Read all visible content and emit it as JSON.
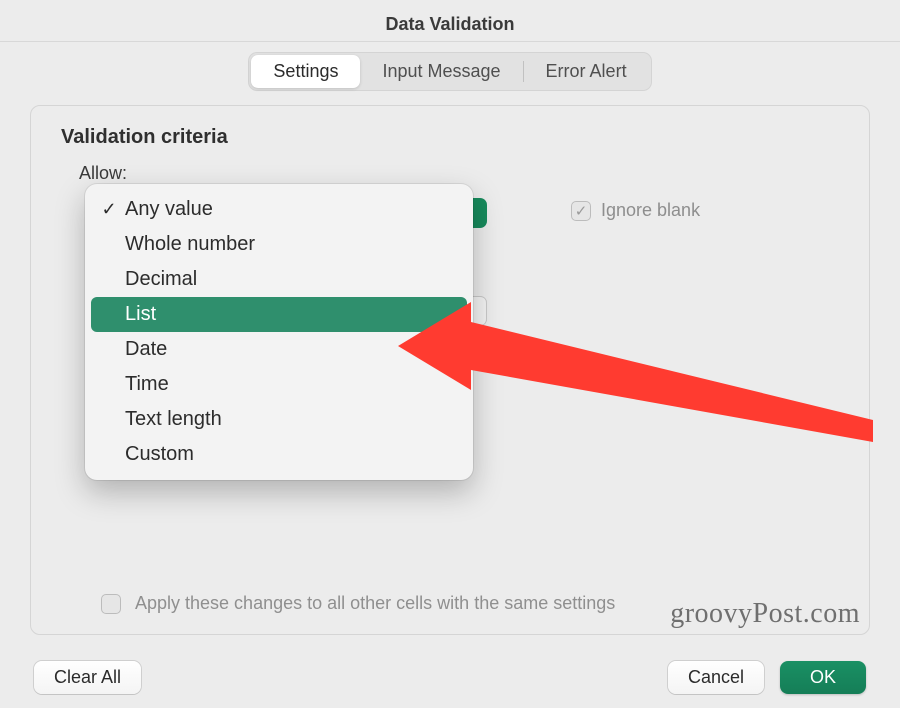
{
  "title": "Data Validation",
  "tabs": {
    "settings": "Settings",
    "input_message": "Input Message",
    "error_alert": "Error Alert"
  },
  "section_title": "Validation criteria",
  "allow_label": "Allow:",
  "ignore_blank": {
    "label": "Ignore blank",
    "checked": true
  },
  "apply_all": {
    "label": "Apply these changes to all other cells with the same settings",
    "checked": false
  },
  "allow_options": {
    "selected": "Any value",
    "highlighted": "List",
    "items": [
      "Any value",
      "Whole number",
      "Decimal",
      "List",
      "Date",
      "Time",
      "Text length",
      "Custom"
    ]
  },
  "buttons": {
    "clear_all": "Clear All",
    "cancel": "Cancel",
    "ok": "OK"
  },
  "watermark": "groovyPost.com",
  "colors": {
    "accent": "#178a5c",
    "highlight": "#2f8f6d",
    "arrow": "#ff3b30"
  }
}
